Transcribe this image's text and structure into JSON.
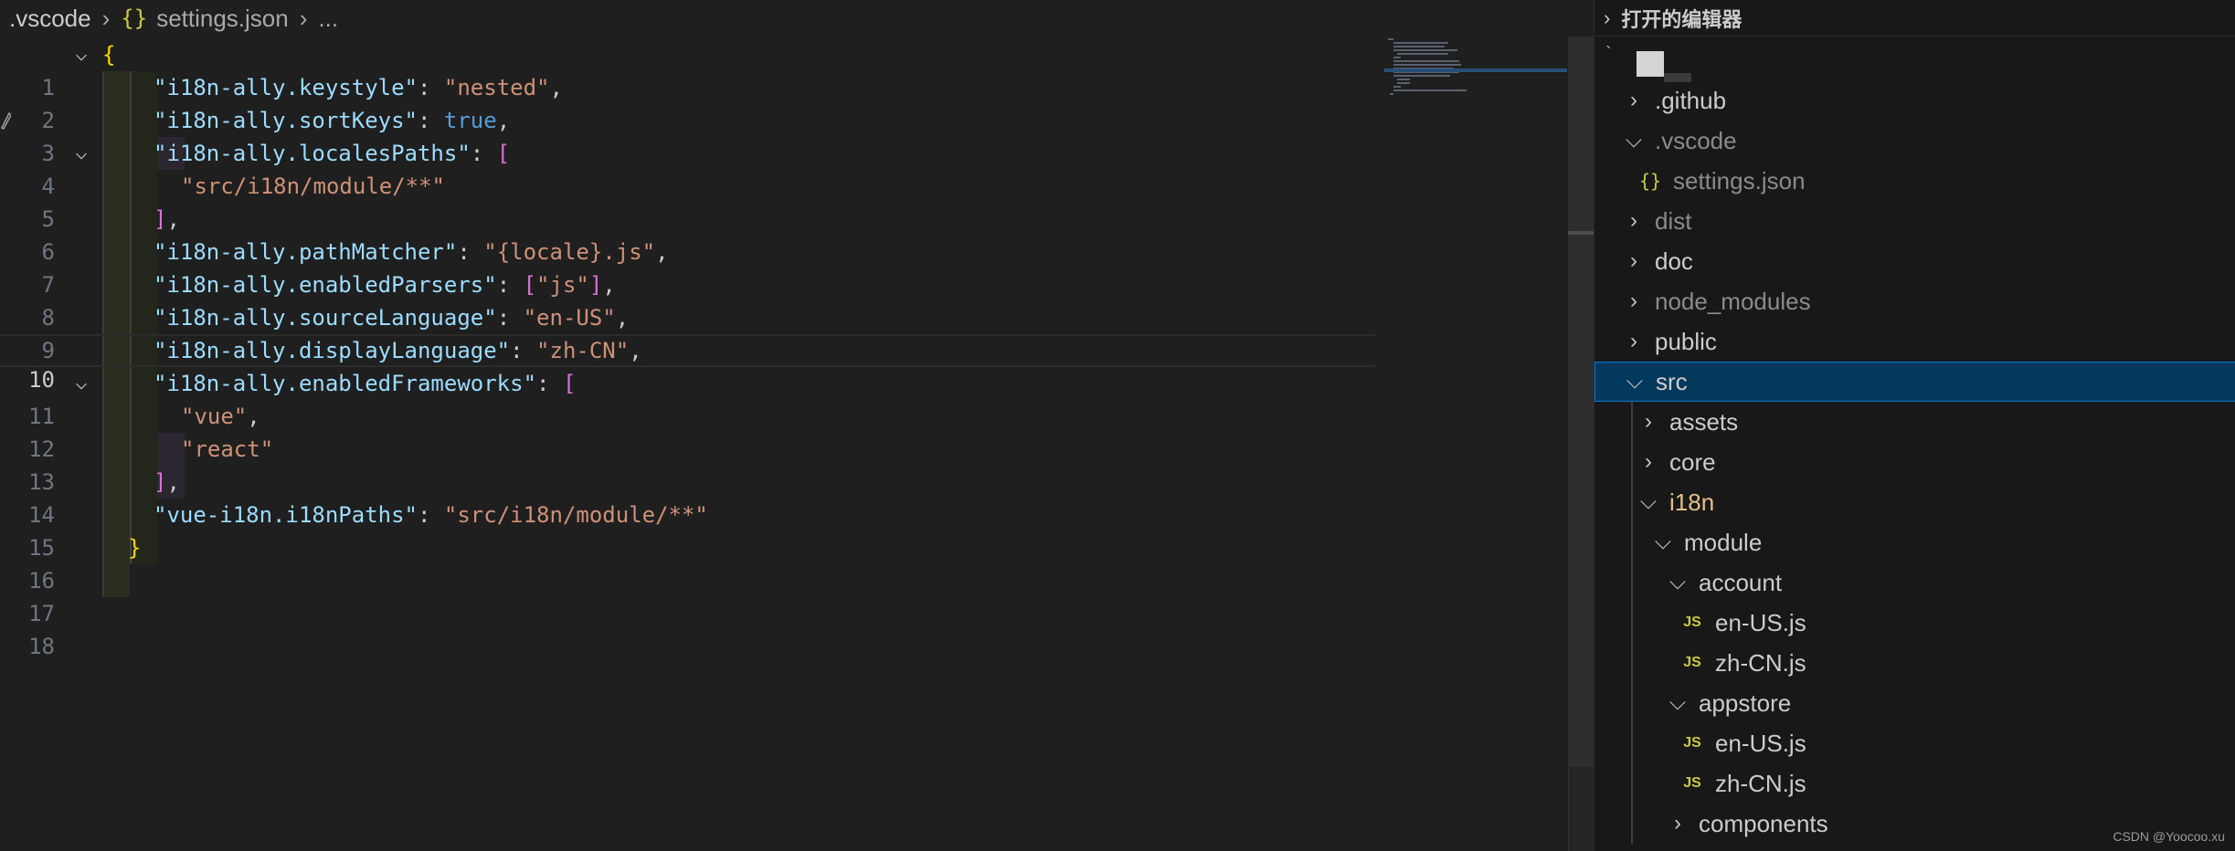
{
  "breadcrumb": {
    "folder": ".vscode",
    "file_icon": "{}",
    "file": "settings.json",
    "more": "..."
  },
  "editor": {
    "current_line": 10,
    "line_numbers": [
      "1",
      "2",
      "3",
      "4",
      "5",
      "6",
      "7",
      "8",
      "9",
      "10",
      "11",
      "12",
      "13",
      "14",
      "15",
      "16",
      "17",
      "18"
    ]
  },
  "explorer": {
    "section_title": "打开的编辑器",
    "root_marker": "`",
    "items": [
      {
        "label": ".github",
        "type": "folder",
        "expanded": false,
        "depth": 0
      },
      {
        "label": ".vscode",
        "type": "folder",
        "expanded": true,
        "depth": 0,
        "dim": true
      },
      {
        "label": "settings.json",
        "type": "json",
        "depth": 1,
        "dim": true
      },
      {
        "label": "dist",
        "type": "folder",
        "expanded": false,
        "depth": 0,
        "dim": true
      },
      {
        "label": "doc",
        "type": "folder",
        "expanded": false,
        "depth": 0
      },
      {
        "label": "node_modules",
        "type": "folder",
        "expanded": false,
        "depth": 0,
        "dim": true
      },
      {
        "label": "public",
        "type": "folder",
        "expanded": false,
        "depth": 0
      },
      {
        "label": "src",
        "type": "folder",
        "expanded": true,
        "depth": 0,
        "selected": true
      },
      {
        "label": "assets",
        "type": "folder",
        "expanded": false,
        "depth": 1
      },
      {
        "label": "core",
        "type": "folder",
        "expanded": false,
        "depth": 1
      },
      {
        "label": "i18n",
        "type": "folder",
        "expanded": true,
        "depth": 1,
        "modified": true
      },
      {
        "label": "module",
        "type": "folder",
        "expanded": true,
        "depth": 2
      },
      {
        "label": "account",
        "type": "folder",
        "expanded": true,
        "depth": 3
      },
      {
        "label": "en-US.js",
        "type": "js",
        "depth": 4
      },
      {
        "label": "zh-CN.js",
        "type": "js",
        "depth": 4
      },
      {
        "label": "appstore",
        "type": "folder",
        "expanded": true,
        "depth": 3
      },
      {
        "label": "en-US.js",
        "type": "js",
        "depth": 4
      },
      {
        "label": "zh-CN.js",
        "type": "js",
        "depth": 4
      },
      {
        "label": "components",
        "type": "folder",
        "expanded": false,
        "depth": 3
      }
    ],
    "js_icon_text": "JS"
  },
  "watermark": "CSDN @Yoocoo.xu",
  "colors": {
    "background": "#1f1f1f",
    "key": "#9cdcfe",
    "string": "#ce9178",
    "bracket_level1": "#ffd700",
    "bracket_level2": "#da70d6",
    "keyword": "#569cd6",
    "selection": "#04395e",
    "modified": "#e2c08d"
  }
}
